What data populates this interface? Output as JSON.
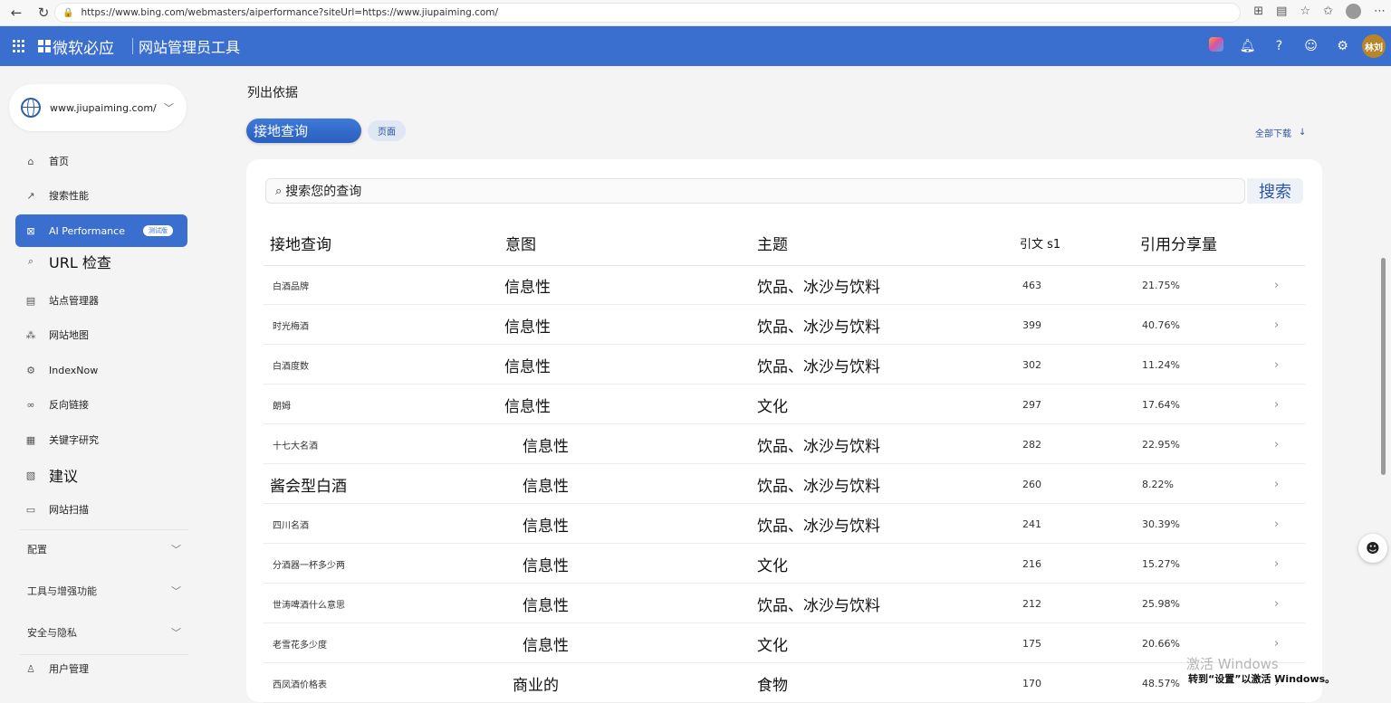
{
  "browser": {
    "url": "https://www.bing.com/webmasters/aiperformance?siteUrl=https://www.jiupaiming.com/"
  },
  "header": {
    "brand": "微软必应",
    "product": "网站管理员工具",
    "avatar": "林刘"
  },
  "sidebar": {
    "site": "www.jiupaiming.com/",
    "items": [
      {
        "label": "首页",
        "icon": "home-icon"
      },
      {
        "label": "搜索性能",
        "icon": "trend-icon"
      },
      {
        "label": "AI Performance",
        "icon": "ai-performance-icon",
        "badge": "测试版"
      },
      {
        "label": "URL 检查",
        "icon": "search-icon"
      },
      {
        "label": "站点管理器",
        "icon": "site-manager-icon"
      },
      {
        "label": "网站地图",
        "icon": "sitemap-icon"
      },
      {
        "label": "IndexNow",
        "icon": "indexnow-icon"
      },
      {
        "label": "反向链接",
        "icon": "backlink-icon"
      },
      {
        "label": "关键字研究",
        "icon": "keyword-icon"
      },
      {
        "label": "建议",
        "icon": "recommendation-icon"
      },
      {
        "label": "网站扫描",
        "icon": "site-scan-icon"
      }
    ],
    "sections": [
      "配置",
      "工具与增强功能",
      "安全与隐私"
    ],
    "user_mgmt": "用户管理"
  },
  "main": {
    "list_by": "列出依据",
    "tabs": [
      "接地查询",
      "页面"
    ],
    "download_all": "全部下载",
    "search": {
      "placeholder": "搜索您的查询",
      "button": "搜索"
    },
    "columns": [
      "接地查询",
      "意图",
      "主题",
      "引文 s1",
      "引用分享量"
    ],
    "rows": [
      {
        "query": "白酒品牌",
        "intent": "信息性",
        "topic": "饮品、冰沙与饮料",
        "citations": "463",
        "share": "21.75%"
      },
      {
        "query": "时光梅酒",
        "intent": "信息性",
        "topic": "饮品、冰沙与饮料",
        "citations": "399",
        "share": "40.76%"
      },
      {
        "query": "白酒度数",
        "intent": "信息性",
        "topic": "饮品、冰沙与饮料",
        "citations": "302",
        "share": "11.24%"
      },
      {
        "query": "朗姆",
        "intent": "信息性",
        "topic": "文化",
        "citations": "297",
        "share": "17.64%"
      },
      {
        "query": "十七大名酒",
        "intent": "信息性",
        "topic": "饮品、冰沙与饮料",
        "citations": "282",
        "share": "22.95%"
      },
      {
        "query": "酱会型白酒",
        "intent": "信息性",
        "topic": "饮品、冰沙与饮料",
        "citations": "260",
        "share": "8.22%"
      },
      {
        "query": "四川名酒",
        "intent": "信息性",
        "topic": "饮品、冰沙与饮料",
        "citations": "241",
        "share": "30.39%"
      },
      {
        "query": "分酒器一杯多少两",
        "intent": "信息性",
        "topic": "文化",
        "citations": "216",
        "share": "15.27%"
      },
      {
        "query": "世涛啤酒什么意思",
        "intent": "信息性",
        "topic": "饮品、冰沙与饮料",
        "citations": "212",
        "share": "25.98%"
      },
      {
        "query": "老雪花多少度",
        "intent": "信息性",
        "topic": "文化",
        "citations": "175",
        "share": "20.66%"
      },
      {
        "query": "西凤酒价格表",
        "intent": "商业的",
        "topic": "食物",
        "citations": "170",
        "share": "48.57%"
      }
    ]
  },
  "watermark": {
    "line1": "激活 Windows",
    "line2": "转到“设置”以激活 Windows。"
  }
}
